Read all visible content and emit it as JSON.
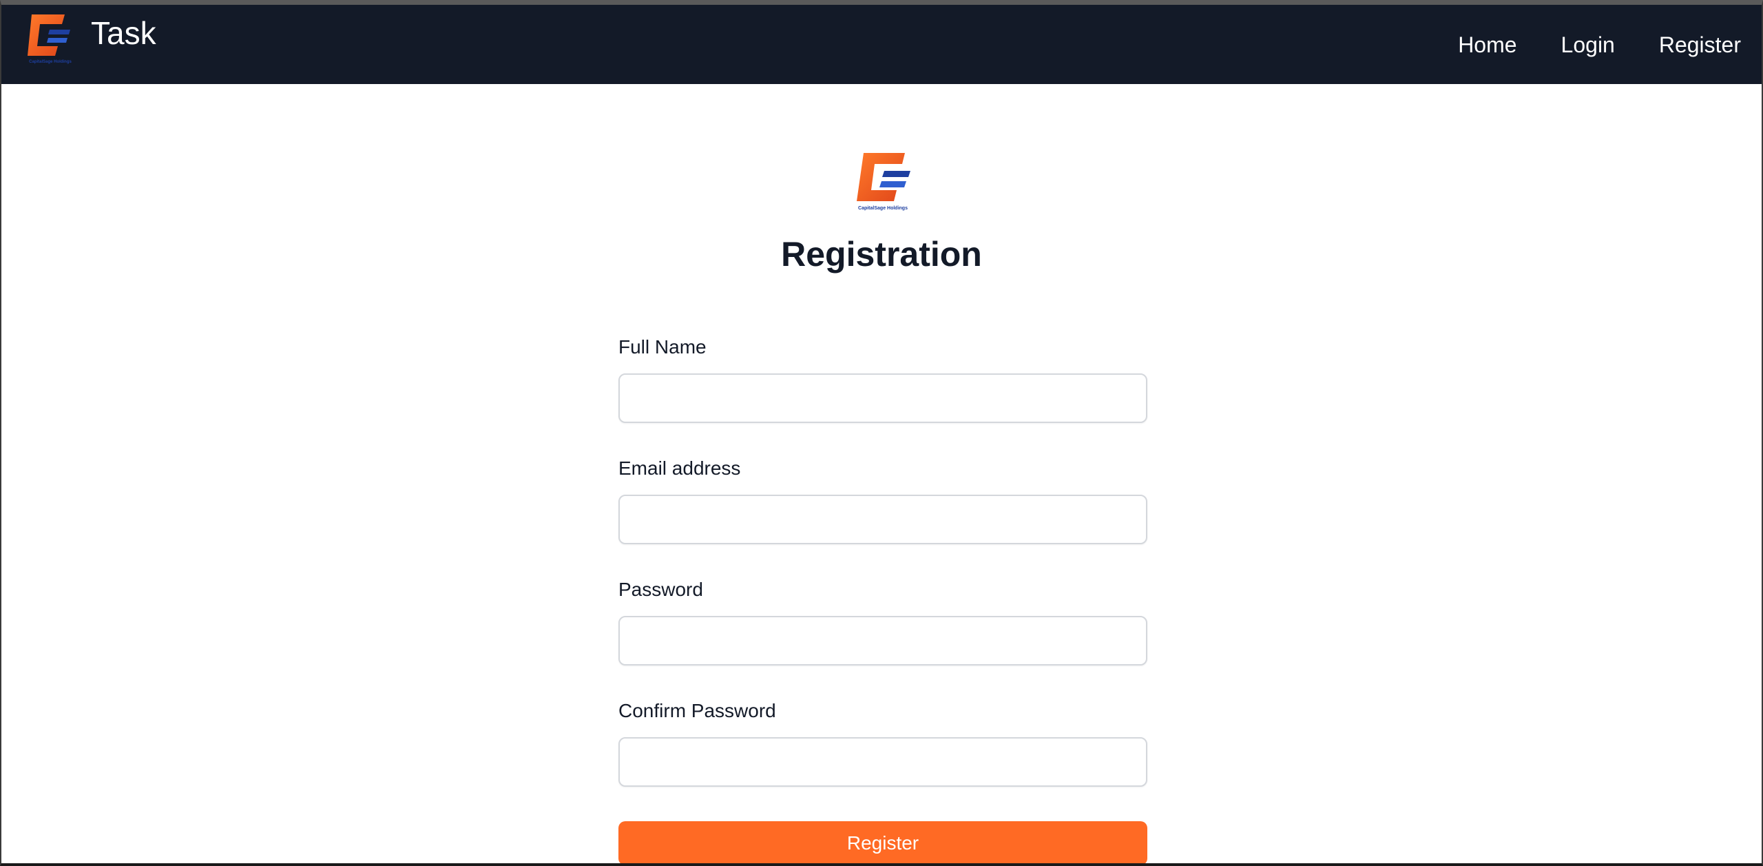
{
  "navbar": {
    "brand_title": "Task",
    "brand_logo_icon": "capitalsage-logo-icon",
    "links": [
      {
        "label": "Home"
      },
      {
        "label": "Login"
      },
      {
        "label": "Register"
      }
    ]
  },
  "main": {
    "title": "Registration",
    "logo_caption": "CapitalSage Holdings",
    "form": {
      "fields": [
        {
          "label": "Full Name",
          "value": "",
          "placeholder": ""
        },
        {
          "label": "Email address",
          "value": "",
          "placeholder": ""
        },
        {
          "label": "Password",
          "value": "",
          "placeholder": ""
        },
        {
          "label": "Confirm Password",
          "value": "",
          "placeholder": ""
        }
      ],
      "submit_label": "Register"
    }
  },
  "colors": {
    "navbar_bg": "#131a28",
    "accent": "#ff6a24",
    "logo_blue": "#1e3fa0"
  }
}
